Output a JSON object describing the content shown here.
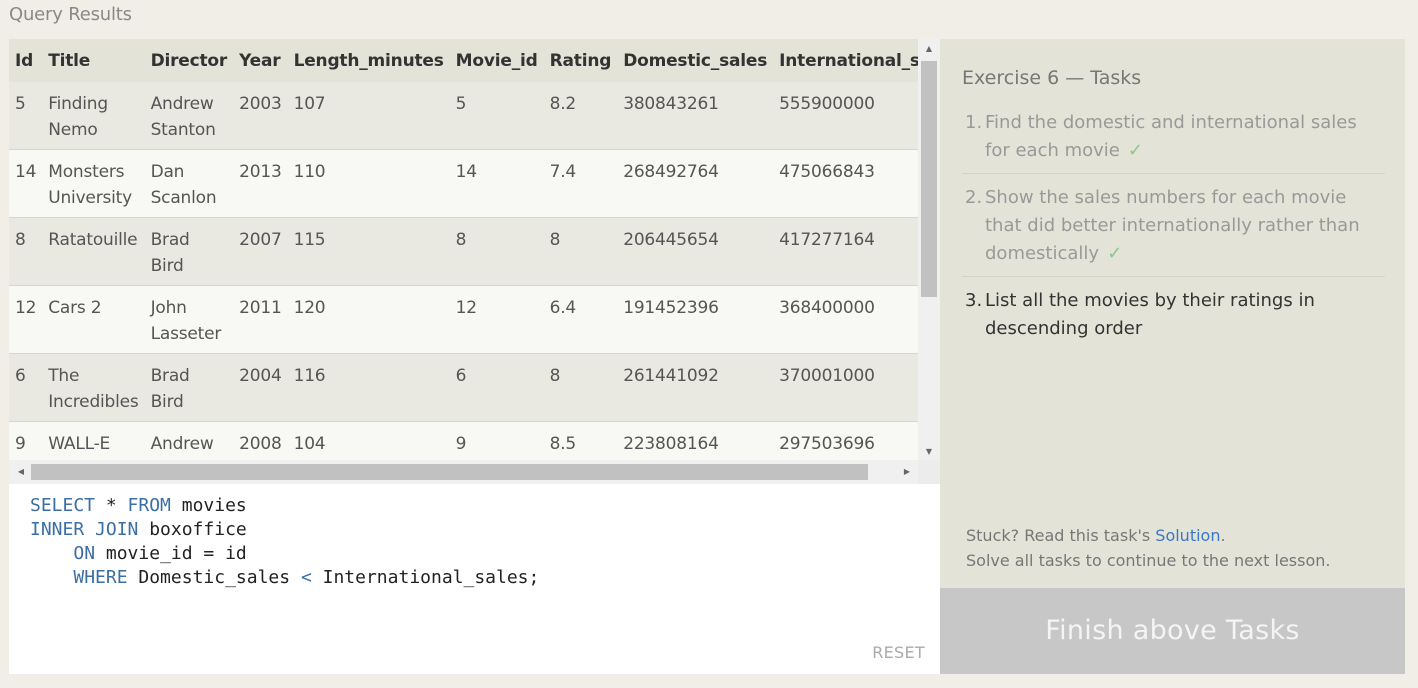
{
  "results_title": "Query Results",
  "table": {
    "columns": [
      "Id",
      "Title",
      "Director",
      "Year",
      "Length_minutes",
      "Movie_id",
      "Rating",
      "Domestic_sales",
      "International_sales"
    ],
    "rows": [
      [
        "5",
        "Finding Nemo",
        "Andrew Stanton",
        "2003",
        "107",
        "5",
        "8.2",
        "380843261",
        "555900000"
      ],
      [
        "14",
        "Monsters University",
        "Dan Scanlon",
        "2013",
        "110",
        "14",
        "7.4",
        "268492764",
        "475066843"
      ],
      [
        "8",
        "Ratatouille",
        "Brad Bird",
        "2007",
        "115",
        "8",
        "8",
        "206445654",
        "417277164"
      ],
      [
        "12",
        "Cars 2",
        "John Lasseter",
        "2011",
        "120",
        "12",
        "6.4",
        "191452396",
        "368400000"
      ],
      [
        "6",
        "The Incredibles",
        "Brad Bird",
        "2004",
        "116",
        "6",
        "8",
        "261441092",
        "370001000"
      ],
      [
        "9",
        "WALL-E",
        "Andrew Stanton",
        "2008",
        "104",
        "9",
        "8.5",
        "223808164",
        "297503696"
      ]
    ]
  },
  "editor": {
    "lines": [
      [
        "SELECT",
        " * ",
        "FROM",
        " movies"
      ],
      [
        "INNER JOIN",
        " boxoffice"
      ],
      [
        "    ",
        "ON",
        " movie_id = id"
      ],
      [
        "    ",
        "WHERE",
        " Domestic_sales ",
        "<",
        " International_sales;"
      ]
    ],
    "reset_label": "RESET"
  },
  "exercise": {
    "title": "Exercise 6 — Tasks",
    "tasks": [
      {
        "num": "1.",
        "text": "Find the domestic and international sales for each movie",
        "done": true,
        "check": "✓"
      },
      {
        "num": "2.",
        "text": "Show the sales numbers for each movie that did better internationally rather than domestically",
        "done": true,
        "check": "✓"
      },
      {
        "num": "3.",
        "text": "List all the movies by their ratings in descending order",
        "done": false
      }
    ],
    "stuck_prefix": "Stuck? Read this task's ",
    "solution_link": "Solution",
    "stuck_suffix": ".",
    "continue_text": "Solve all tasks to continue to the next lesson.",
    "finish_button": "Finish above Tasks"
  },
  "colors": {
    "keyword": "#3b6fa3",
    "link": "#3a77c9",
    "check": "#8cc68c",
    "finish_bg": "#c7c7c7"
  }
}
